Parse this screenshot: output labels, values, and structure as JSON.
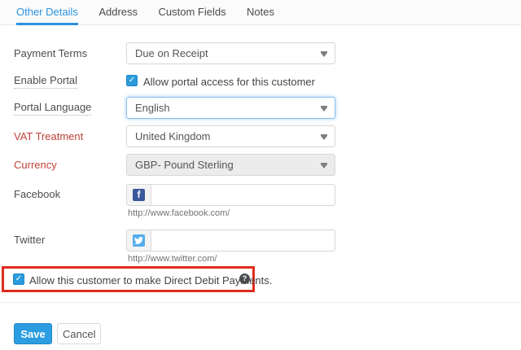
{
  "tabs": {
    "other_details": "Other Details",
    "address": "Address",
    "custom_fields": "Custom Fields",
    "notes": "Notes"
  },
  "fields": {
    "payment_terms": {
      "label": "Payment Terms",
      "value": "Due on Receipt"
    },
    "enable_portal": {
      "label": "Enable Portal",
      "option": "Allow portal access for this customer",
      "checked": true
    },
    "portal_language": {
      "label": "Portal Language",
      "value": "English",
      "focused": true
    },
    "vat_treatment": {
      "label": "VAT Treatment",
      "value": "United Kingdom"
    },
    "currency": {
      "label": "Currency",
      "value": "GBP- Pound Sterling",
      "disabled": true
    },
    "facebook": {
      "label": "Facebook",
      "value": "",
      "hint": "http://www.facebook.com/"
    },
    "twitter": {
      "label": "Twitter",
      "value": "",
      "hint": "http://www.twitter.com/"
    }
  },
  "direct_debit": {
    "option": "Allow this customer to make Direct Debit Payments.",
    "checked": true,
    "highlighted": true
  },
  "actions": {
    "save": "Save",
    "cancel": "Cancel"
  },
  "glyphs": {
    "checkmark": "✓",
    "facebook_f": "f",
    "help": "?"
  },
  "colors": {
    "accent_blue": "#2b93dd",
    "label_red": "#bf4038",
    "highlight_red": "#e02b1e",
    "facebook_blue": "#39579a",
    "twitter_blue": "#55acee",
    "save_button": "#2b9de0"
  }
}
